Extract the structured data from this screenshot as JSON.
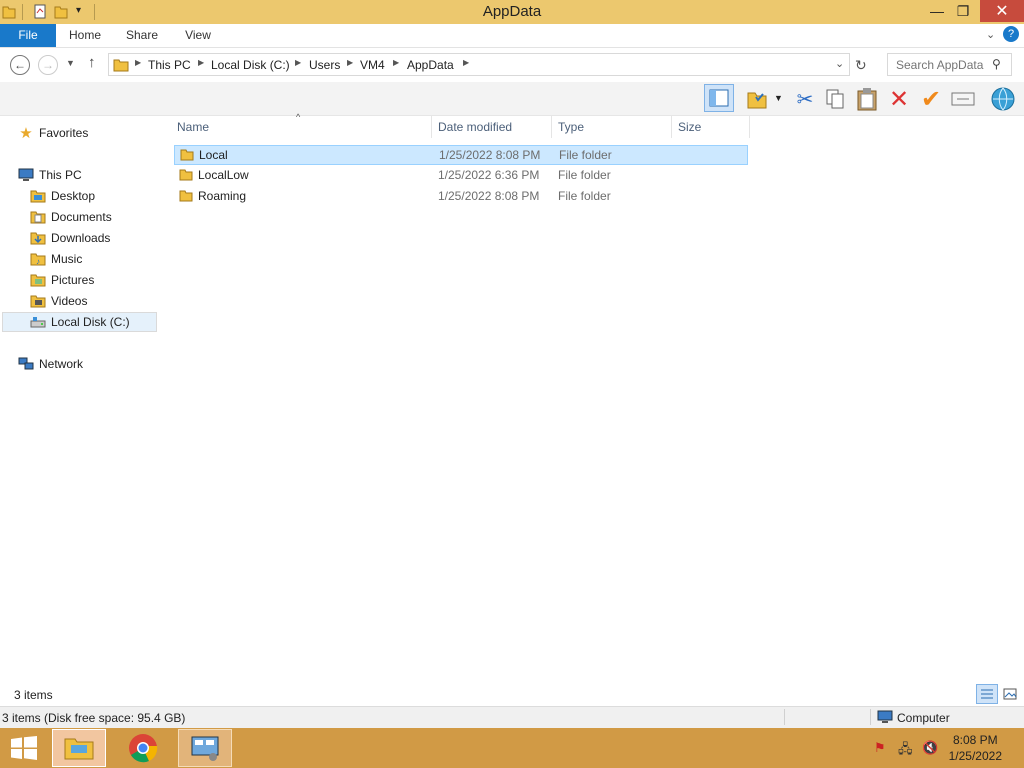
{
  "window": {
    "title": "AppData",
    "controls": {
      "minimize": "—",
      "maximize": "❐",
      "close": "✕"
    }
  },
  "ribbon": {
    "tabs": [
      {
        "label": "File"
      },
      {
        "label": "Home"
      },
      {
        "label": "Share"
      },
      {
        "label": "View"
      }
    ],
    "expand_icon": "chevron-down-icon",
    "help_icon": "help-icon"
  },
  "address": {
    "breadcrumbs": [
      "This PC",
      "Local Disk (C:)",
      "Users",
      "VM4",
      "AppData"
    ],
    "search_placeholder": "Search AppData"
  },
  "navigation": {
    "favorites": "Favorites",
    "this_pc": "This PC",
    "pc_items": [
      {
        "label": "Desktop"
      },
      {
        "label": "Documents"
      },
      {
        "label": "Downloads"
      },
      {
        "label": "Music"
      },
      {
        "label": "Pictures"
      },
      {
        "label": "Videos"
      },
      {
        "label": "Local Disk (C:)"
      }
    ],
    "network": "Network"
  },
  "file_list": {
    "columns": [
      "Name",
      "Date modified",
      "Type",
      "Size"
    ],
    "sort_column": "Name",
    "rows": [
      {
        "name": "Local",
        "date": "1/25/2022 8:08 PM",
        "type": "File folder",
        "size": ""
      },
      {
        "name": "LocalLow",
        "date": "1/25/2022 6:36 PM",
        "type": "File folder",
        "size": ""
      },
      {
        "name": "Roaming",
        "date": "1/25/2022 8:08 PM",
        "type": "File folder",
        "size": ""
      }
    ],
    "selected_row": "Local"
  },
  "status": {
    "item_count": "3 items",
    "details": "3 items (Disk free space: 95.4 GB)",
    "location": "Computer"
  },
  "taskbar": {
    "time": "8:08 PM",
    "date": "1/25/2022"
  },
  "colors": {
    "title_bar": "#ecc86e",
    "file_tab": "#1979ca",
    "close_button": "#c74b3d",
    "selection": "#cce8ff",
    "taskbar": "#d19a45"
  }
}
